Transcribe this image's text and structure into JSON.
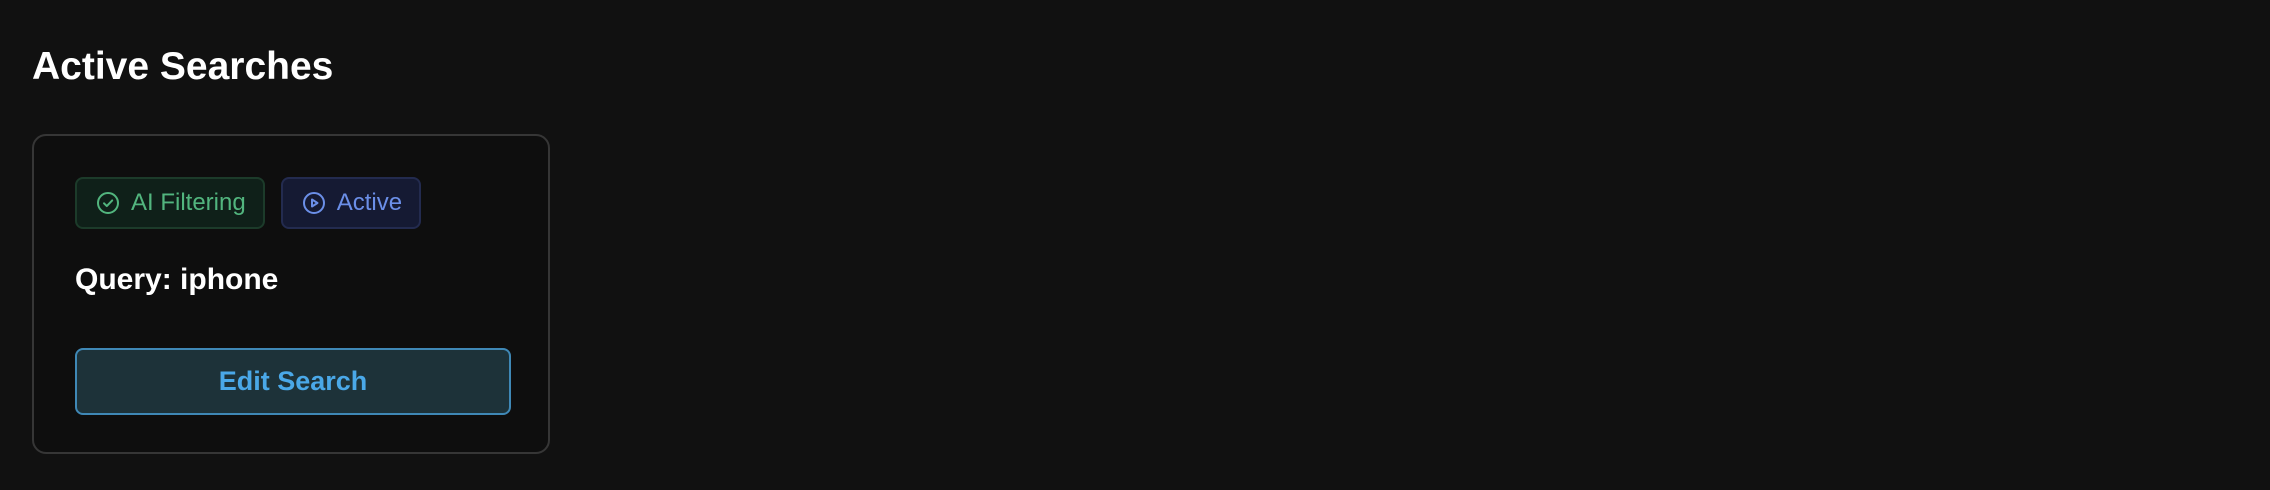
{
  "header": {
    "title": "Active Searches"
  },
  "search_card": {
    "badges": {
      "ai_filtering": {
        "label": "AI Filtering",
        "icon": "check-circle-icon",
        "color": "#52b57e"
      },
      "status": {
        "label": "Active",
        "icon": "play-circle-icon",
        "color": "#6b8fe8"
      }
    },
    "query_text": "Query: iphone",
    "edit_button_label": "Edit Search",
    "accent_color": "#4aa8e8"
  }
}
